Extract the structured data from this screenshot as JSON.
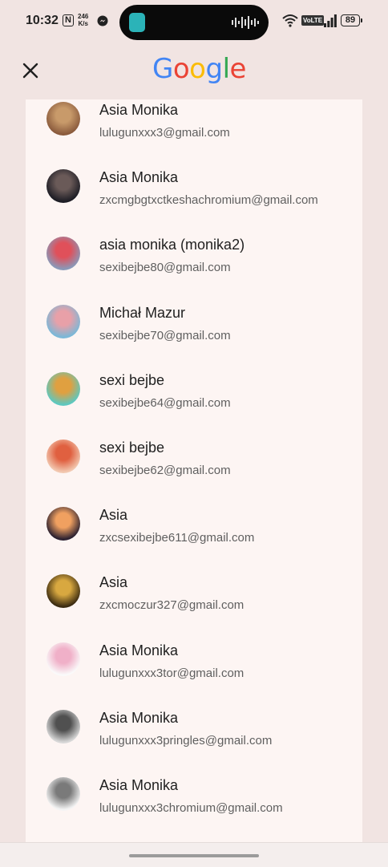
{
  "status_bar": {
    "time": "10:32",
    "nfc_label": "N",
    "net_speed_value": "246",
    "net_speed_unit": "K/s",
    "volte_label": "VoLTE",
    "battery_level": "89"
  },
  "header": {
    "close_icon": "close-icon",
    "logo_letters": [
      {
        "char": "G",
        "color": "#4285F4"
      },
      {
        "char": "o",
        "color": "#EA4335"
      },
      {
        "char": "o",
        "color": "#FBBC05"
      },
      {
        "char": "g",
        "color": "#4285F4"
      },
      {
        "char": "l",
        "color": "#34A853"
      },
      {
        "char": "e",
        "color": "#EA4335"
      }
    ]
  },
  "accounts": [
    {
      "name": "Asia Monika",
      "email": "lulugunxxx3@gmail.com",
      "avatar_colors": [
        "#8a5a3c",
        "#c89a6a"
      ]
    },
    {
      "name": "Asia Monika",
      "email": "zxcmgbgtxctkeshachromium@gmail.com",
      "avatar_colors": [
        "#1c1c24",
        "#6a5a58"
      ]
    },
    {
      "name": "asia monika (monika2)",
      "email": "sexibejbe80@gmail.com",
      "avatar_colors": [
        "#8a98b8",
        "#e0505a"
      ]
    },
    {
      "name": "Michał Mazur",
      "email": "sexibejbe70@gmail.com",
      "avatar_colors": [
        "#7ab8d8",
        "#e8a0a8"
      ]
    },
    {
      "name": "sexi bejbe",
      "email": "sexibejbe64@gmail.com",
      "avatar_colors": [
        "#5cc8c0",
        "#e0a040"
      ]
    },
    {
      "name": "sexi bejbe",
      "email": "sexibejbe62@gmail.com",
      "avatar_colors": [
        "#f2c8b0",
        "#e06040"
      ]
    },
    {
      "name": "Asia",
      "email": "zxcsexibejbe611@gmail.com",
      "avatar_colors": [
        "#2a2030",
        "#f0a060"
      ]
    },
    {
      "name": "Asia",
      "email": "zxcmoczur327@gmail.com",
      "avatar_colors": [
        "#3a2a10",
        "#d8a840"
      ]
    },
    {
      "name": "Asia Monika",
      "email": "lulugunxxx3tor@gmail.com",
      "avatar_colors": [
        "#fafafa",
        "#f0b0c8"
      ]
    },
    {
      "name": "Asia Monika",
      "email": "lulugunxxx3pringles@gmail.com",
      "avatar_colors": [
        "#d8d8d8",
        "#505050"
      ]
    },
    {
      "name": "Asia Monika",
      "email": "lulugunxxx3chromium@gmail.com",
      "avatar_colors": [
        "#f4f4f4",
        "#7a7a7a"
      ]
    }
  ]
}
